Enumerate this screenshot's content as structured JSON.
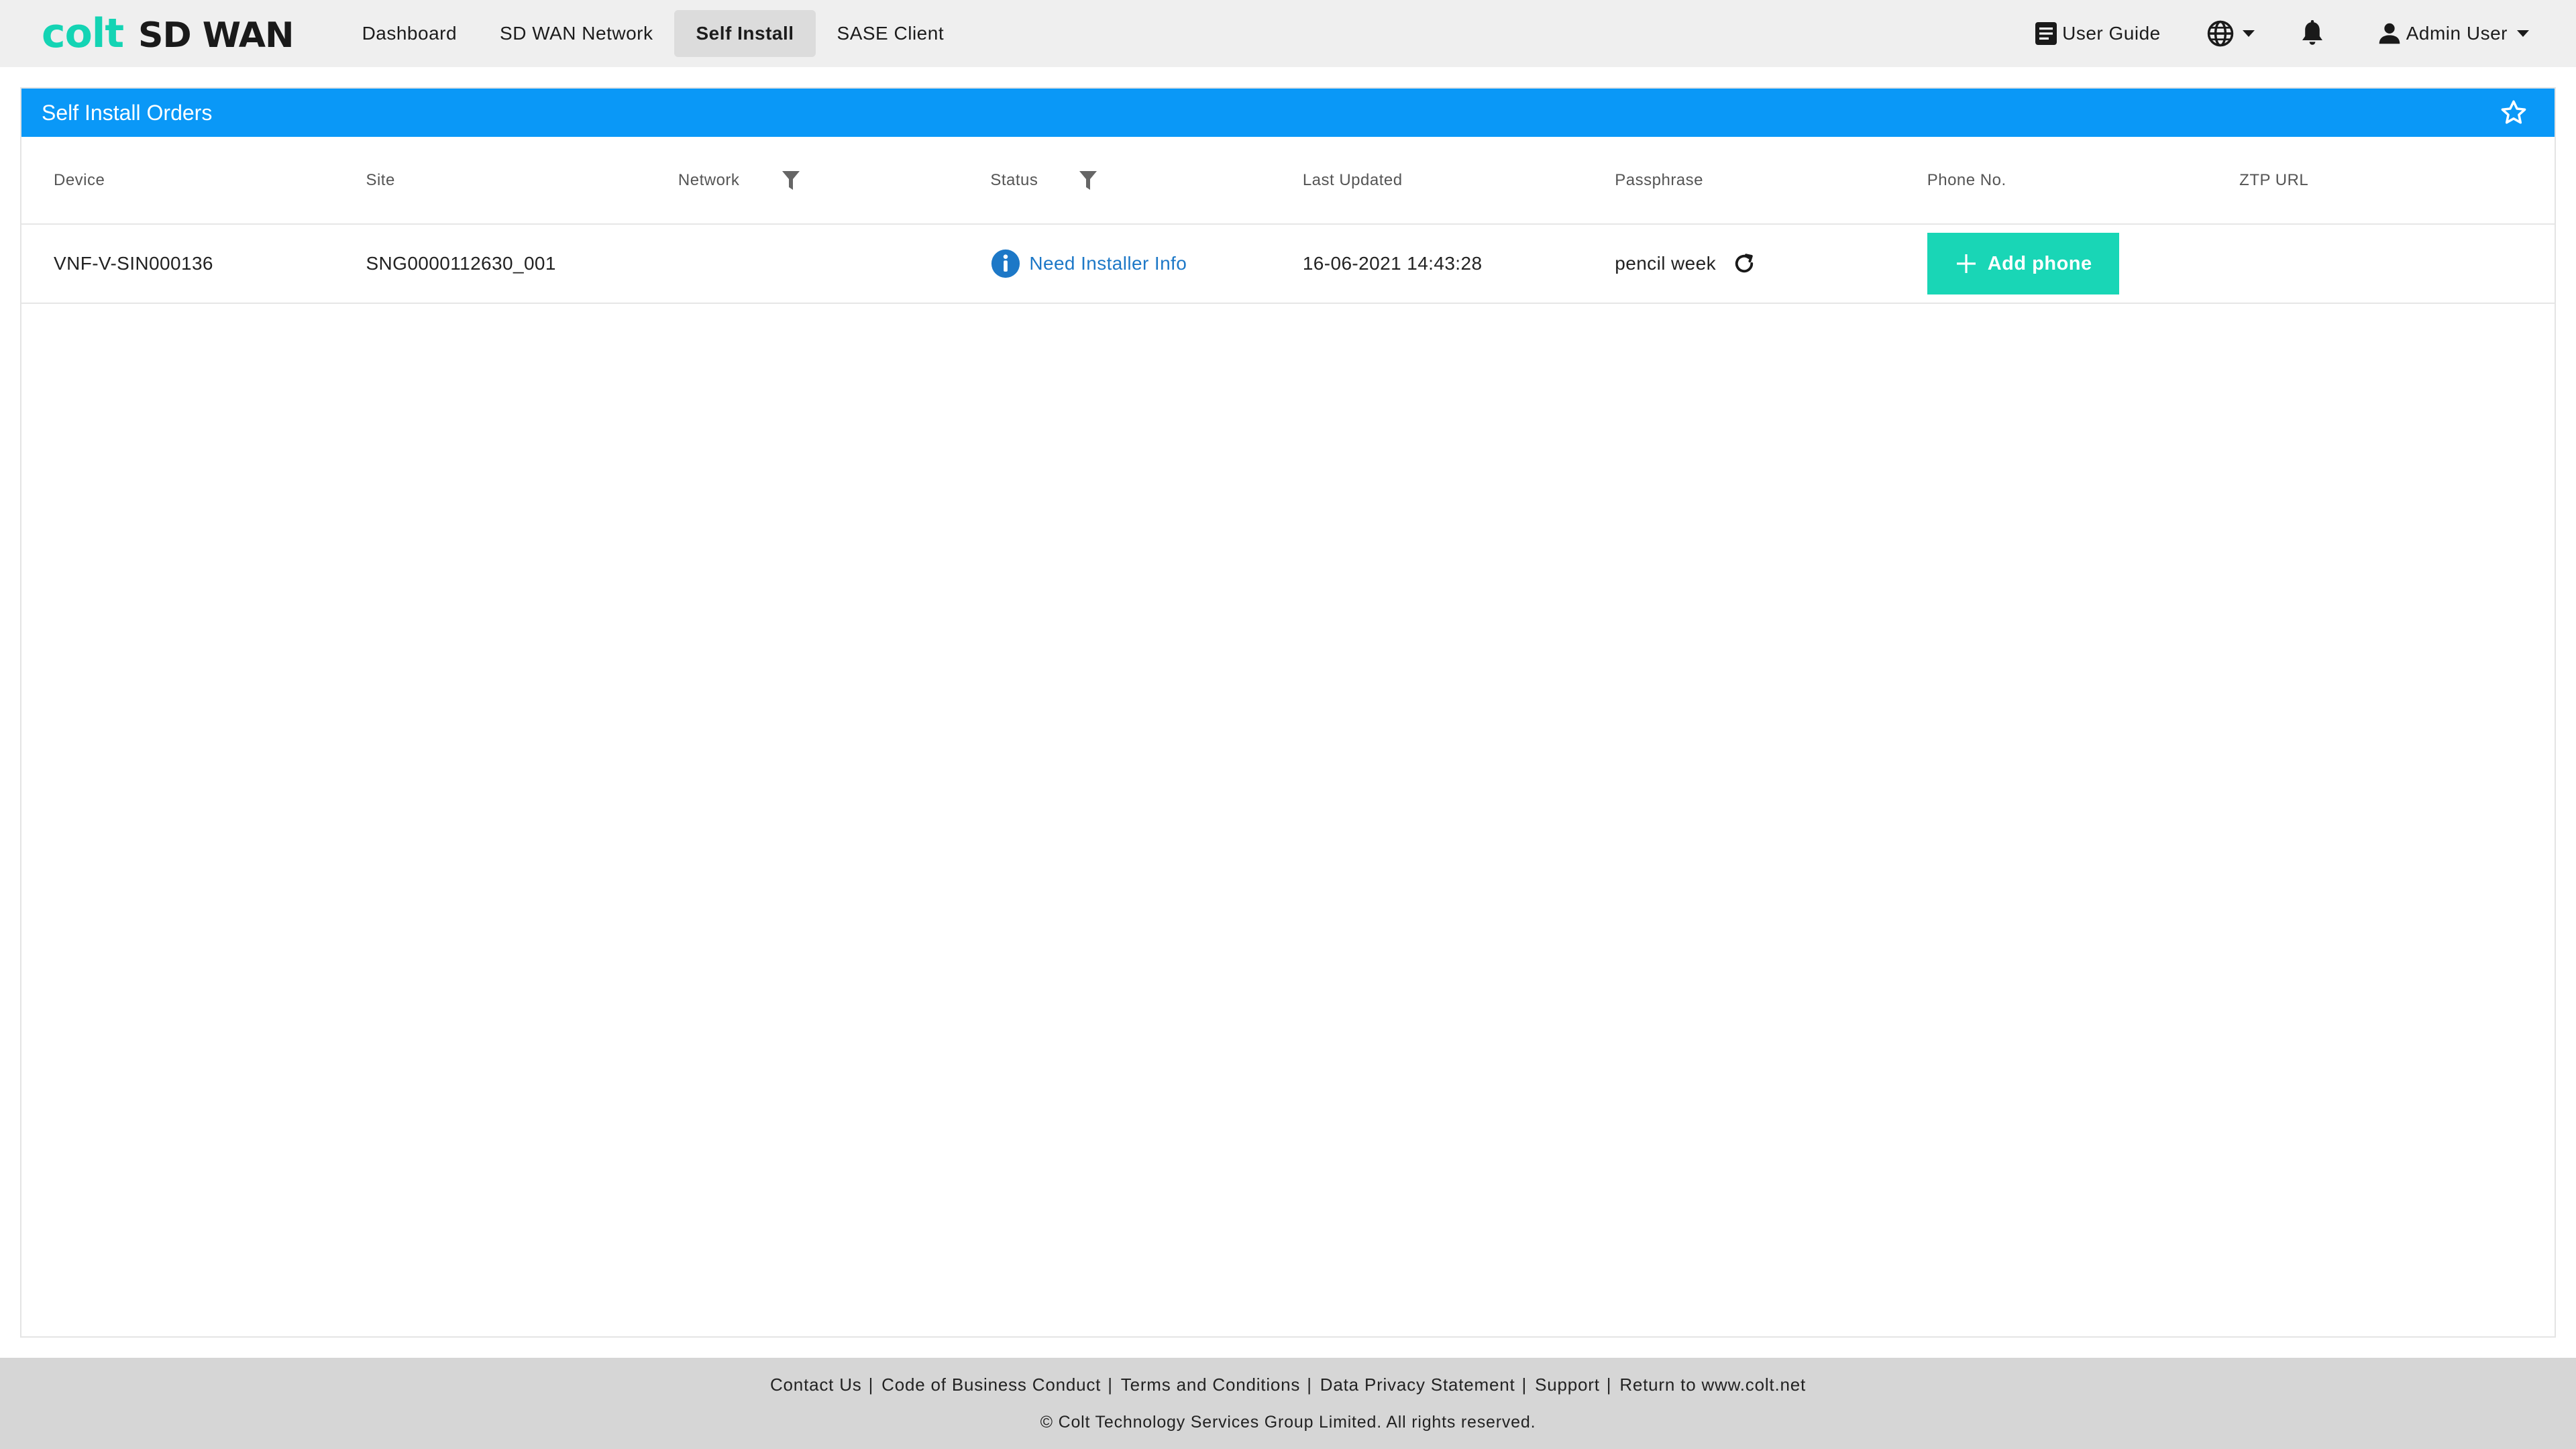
{
  "app": {
    "brand": "colt",
    "product": "SD WAN"
  },
  "nav": {
    "items": [
      {
        "label": "Dashboard",
        "active": false
      },
      {
        "label": "SD WAN Network",
        "active": false
      },
      {
        "label": "Self Install",
        "active": true
      },
      {
        "label": "SASE Client",
        "active": false
      }
    ]
  },
  "topbar": {
    "user_guide": "User Guide",
    "language_icon": "globe-icon",
    "notifications_icon": "bell-icon",
    "user_name": "Admin User"
  },
  "panel": {
    "title": "Self Install Orders",
    "favorite_icon": "star-outline-icon",
    "header_color": "#0a98f7"
  },
  "table": {
    "columns": [
      "Device",
      "Site",
      "Network",
      "Status",
      "Last Updated",
      "Passphrase",
      "Phone No.",
      "ZTP URL"
    ],
    "rows": [
      {
        "device": "VNF-V-SIN000136",
        "site": "SNG0000112630_001",
        "network": "",
        "status": "Need Installer Info",
        "last_updated": "16-06-2021 14:43:28",
        "passphrase": "pencil week",
        "phone_action": "Add phone",
        "ztp_url": ""
      }
    ]
  },
  "footer": {
    "links": [
      "Contact Us",
      "Code of Business Conduct",
      "Terms and Conditions",
      "Data Privacy Statement",
      "Support",
      "Return to www.colt.net"
    ],
    "separator": "|",
    "copyright": "© Colt Technology Services Group Limited. All rights reserved."
  },
  "colors": {
    "accent": "#19d6b6",
    "link": "#1d78c7",
    "topbar_bg": "#efefef",
    "footer_bg": "#d6d6d6"
  }
}
